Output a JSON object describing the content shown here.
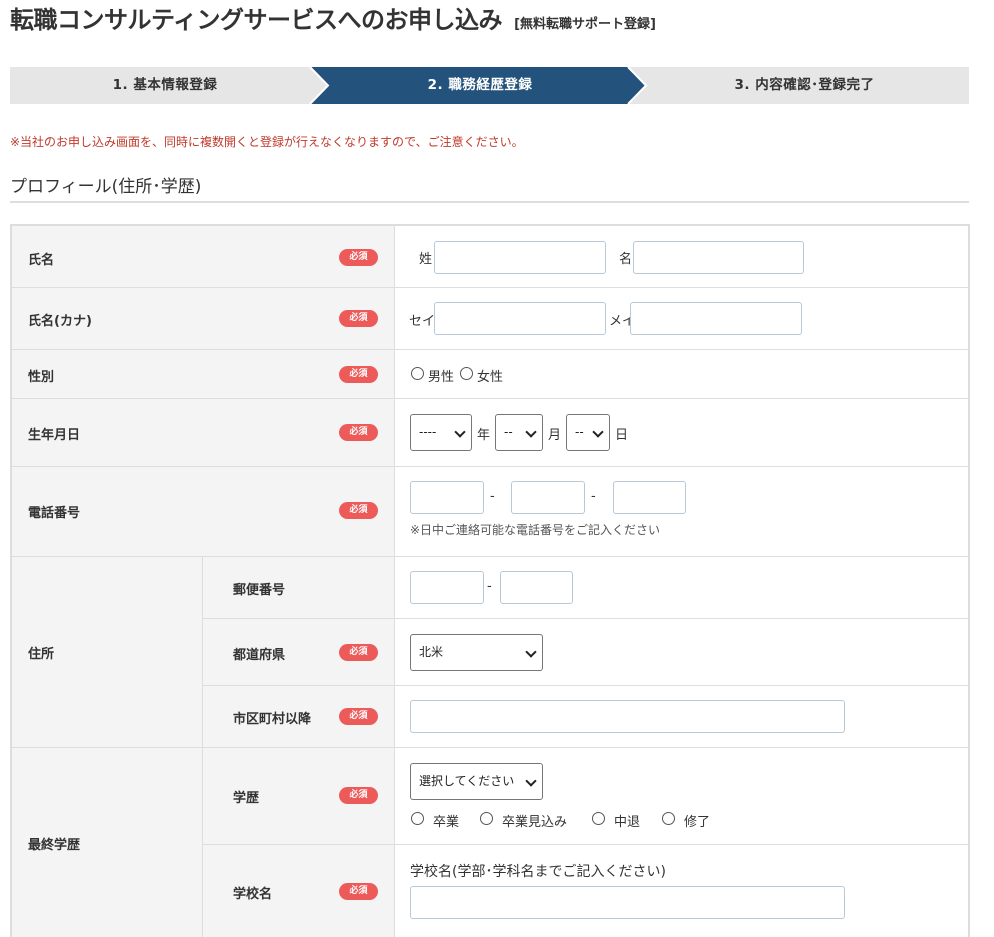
{
  "page": {
    "title": "転職コンサルティングサービスへのお申し込み",
    "subtitle": "[無料転職サポート登録]",
    "notice": "※当社のお申し込み画面を、同時に複数開くと登録が行えなくなりますので、ご注意ください。",
    "section_title": "プロフィール(住所･学歴)"
  },
  "steps": [
    {
      "label": "1. 基本情報登録",
      "state": "done"
    },
    {
      "label": "2. 職務経歴登録",
      "state": "active"
    },
    {
      "label": "3. 内容確認･登録完了",
      "state": "todo"
    }
  ],
  "colors": {
    "active_step": "#23527c",
    "inactive_step": "#e6e6e6",
    "required_badge": "#ec5a5a",
    "notice": "#c0392b"
  },
  "required_label": "必須",
  "form": {
    "name": {
      "label": "氏名",
      "last_prefix": "姓",
      "first_prefix": "名",
      "last_value": "",
      "first_value": ""
    },
    "kana": {
      "label": "氏名(カナ)",
      "last_prefix": "セイ",
      "first_prefix": "メイ",
      "last_value": "",
      "first_value": ""
    },
    "gender": {
      "label": "性別",
      "options": [
        "男性",
        "女性"
      ],
      "selected": null
    },
    "birth": {
      "label": "生年月日",
      "year_value": "----",
      "year_unit": "年",
      "month_value": "--",
      "month_unit": "月",
      "day_value": "--",
      "day_unit": "日"
    },
    "phone": {
      "label": "電話番号",
      "separator": "-",
      "note": "※日中ご連絡可能な電話番号をご記入ください"
    },
    "address": {
      "label": "住所",
      "postal": {
        "label": "郵便番号",
        "separator": "-"
      },
      "prefecture": {
        "label": "都道府県",
        "value": "北米"
      },
      "city": {
        "label": "市区町村以降",
        "value": ""
      }
    },
    "education": {
      "label": "最終学歴",
      "degree": {
        "label": "学歴",
        "select_value": "選択してください",
        "options": [
          "卒業",
          "卒業見込み",
          "中退",
          "修了"
        ]
      },
      "school": {
        "label": "学校名",
        "hint": "学校名(学部･学科名までご記入ください)",
        "value": ""
      }
    }
  }
}
